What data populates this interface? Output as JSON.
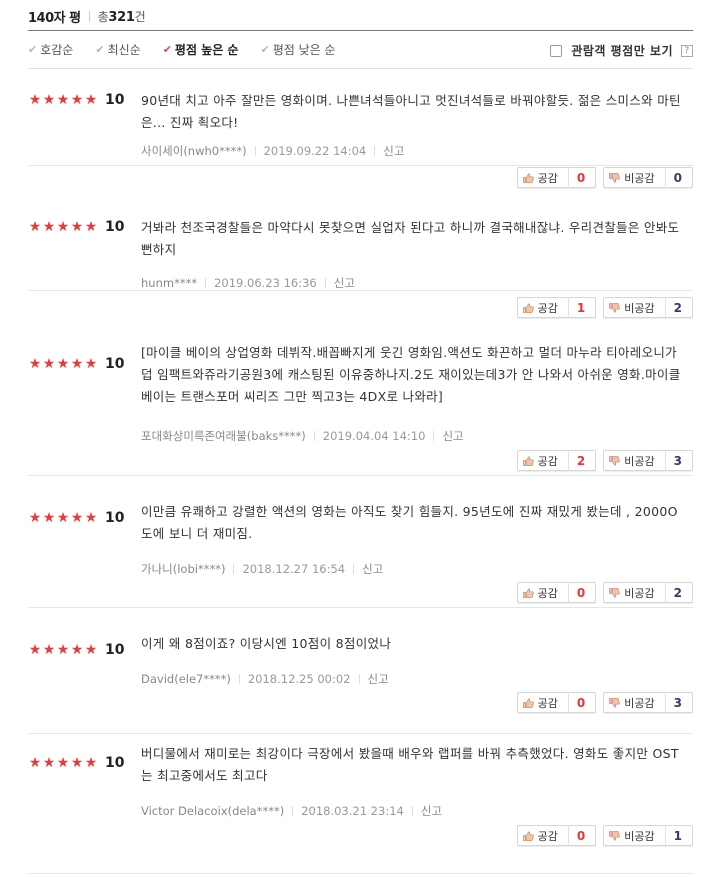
{
  "header": {
    "title": "140자 평",
    "total_prefix": "총",
    "total_count": "321",
    "total_suffix": "건"
  },
  "sort": {
    "items": [
      {
        "label": "호감순",
        "active": false
      },
      {
        "label": "최신순",
        "active": false
      },
      {
        "label": "평점 높은 순",
        "active": true
      },
      {
        "label": "평점 낮은 순",
        "active": false
      }
    ],
    "viewer_only_label": "관람객 평점만 보기",
    "help_label": "?"
  },
  "colors": {
    "star": "#e93a3a",
    "like_count": "#e33333",
    "dislike_count": "#3a3a6a"
  },
  "icons": {
    "star": "star-icon",
    "like": "thumbs-up-icon",
    "dislike": "thumbs-down-icon",
    "check": "check-icon"
  },
  "buttons": {
    "like_label": "공감",
    "dislike_label": "비공감",
    "report_label": "신고"
  },
  "reviews": [
    {
      "score": "10",
      "text": "90년대 치고 아주 잘만든 영화이며. 나쁜녀석들아니고 멋진녀석들로 바꿔야할듯. 젊은 스미스와 마틴은... 진짜 쵝오다!",
      "author": "사이세이(nwh0****)",
      "date": "2019.09.22 14:04",
      "likes": "0",
      "dislikes": "0"
    },
    {
      "score": "10",
      "text": "거봐라 천조국경찰들은 마약다시 못찾으면 실업자 된다고 하니까 결국해내잖냐. 우리견찰들은 안봐도 뻔하지",
      "author": "hunm****",
      "date": "2019.06.23 16:36",
      "likes": "1",
      "dislikes": "2"
    },
    {
      "score": "10",
      "text": "[마이클 베이의 상업영화 데뷔작.배꼽빠지게 웃긴 영화임.액션도 화끈하고 멀더 마누라 티아레오니가 덥 임팩트와쥬라기공원3에 캐스팅된 이유중하나지.2도 재이있는데3가 안 나와서 아쉬운 영화.마이클 베이는 트랜스포머 씨리즈 그만 찍고3는 4DX로 나와라]",
      "author": "포대화상미륵존여래불(baks****)",
      "date": "2019.04.04 14:10",
      "likes": "2",
      "dislikes": "3"
    },
    {
      "score": "10",
      "text": "이만큼 유쾌하고 강렬한 액션의 영화는 아직도 찾기 힘들지. 95년도에 진짜 재밌게 봤는데 , 2000O도에 보니 더 재미짐.",
      "author": "가나니(lobi****)",
      "date": "2018.12.27 16:54",
      "likes": "0",
      "dislikes": "2"
    },
    {
      "score": "10",
      "text": "이게 왜 8점이죠? 이당시엔 10점이 8점이었나",
      "author": "David(ele7****)",
      "date": "2018.12.25 00:02",
      "likes": "0",
      "dislikes": "3"
    },
    {
      "score": "10",
      "text": "버디물에서 재미로는 최강이다 극장에서 봤을때 배우와 랩퍼를 바꿔 추측했었다. 영화도 좋지만 OST는 최고중에서도 최고다",
      "author": "Victor Delacoix(dela****)",
      "date": "2018.03.21 23:14",
      "likes": "0",
      "dislikes": "1"
    }
  ]
}
